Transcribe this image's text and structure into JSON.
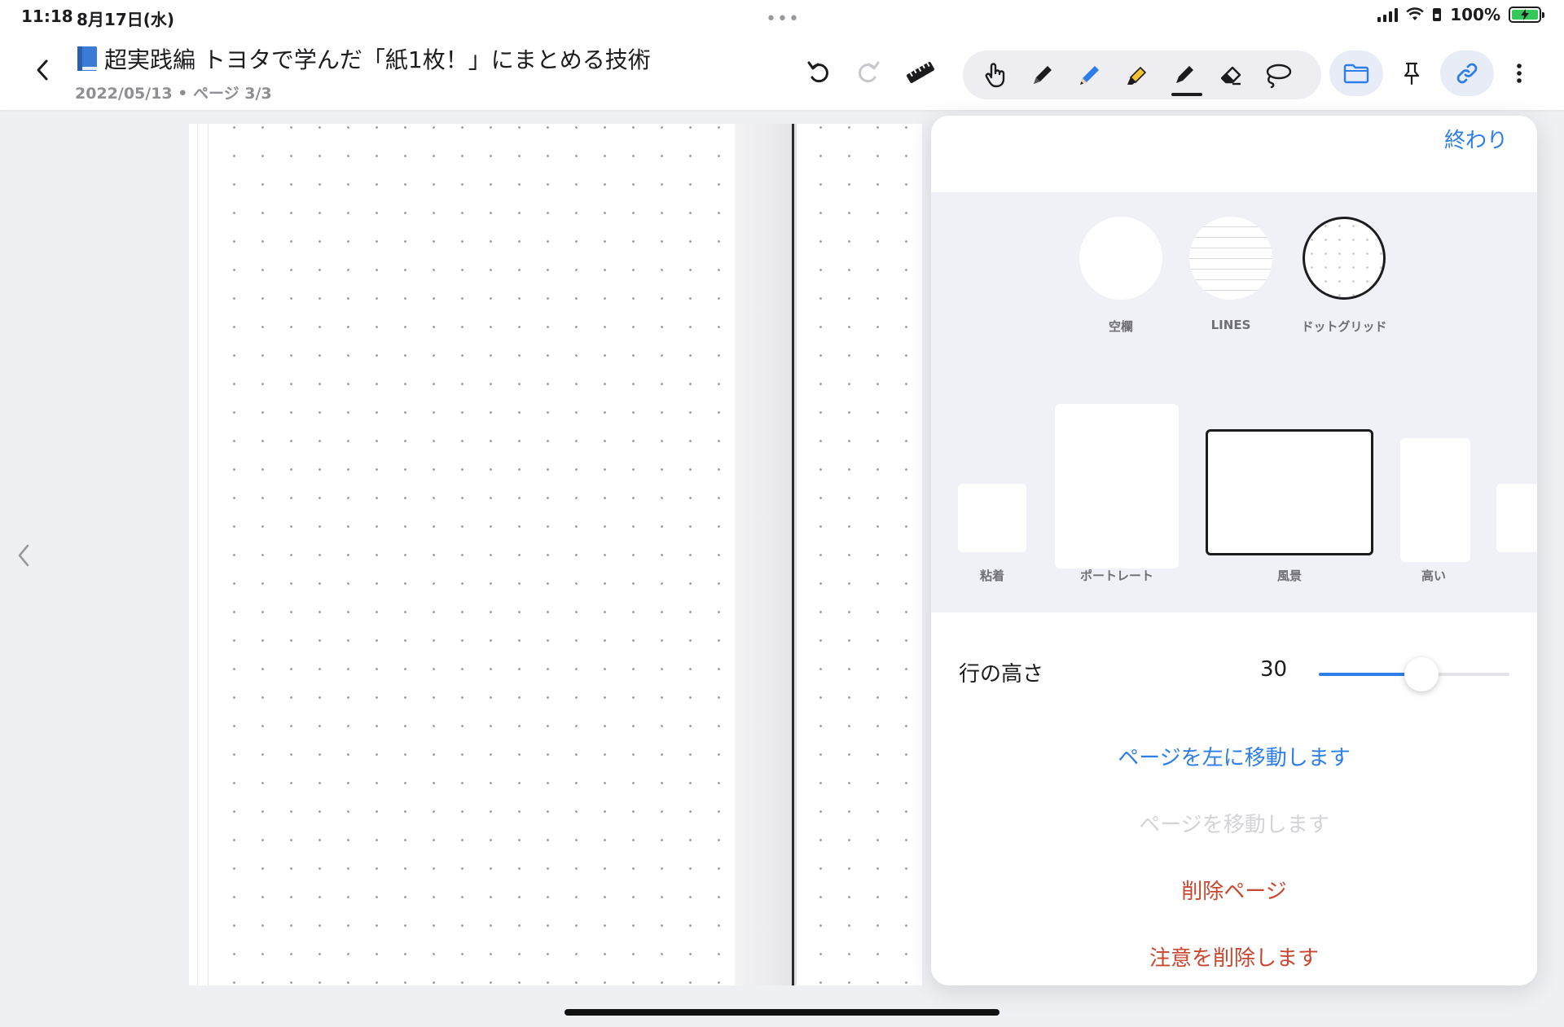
{
  "status_bar": {
    "time": "11:18",
    "date": "8月17日(水)",
    "multitask": "•••",
    "battery_percent": "100%"
  },
  "header": {
    "title": "超実践編 トヨタで学んだ「紙1枚！」にまとめる技術",
    "subtitle": "2022/05/13 • ページ 3/3",
    "icons": {
      "back": "chevron-left-icon",
      "book": "blue-book-icon",
      "undo": "undo-icon",
      "redo": "redo-icon",
      "ruler": "ruler-icon",
      "tools": [
        "hand-pointer-icon",
        "pen-icon",
        "pencil-icon",
        "highlighter-icon",
        "marker-icon",
        "eraser-icon",
        "lasso-icon"
      ],
      "active_tool": "marker-icon",
      "folder": "folder-icon",
      "pin": "pin-icon",
      "link": "link-icon",
      "more": "more-vertical-icon"
    }
  },
  "notebook": {
    "template": "dot-grid",
    "spread": "two-page"
  },
  "popover": {
    "done_label": "終わり",
    "templates": [
      {
        "label": "空欄",
        "selected": false
      },
      {
        "label": "LINES",
        "selected": false
      },
      {
        "label": "ドットグリッド",
        "selected": true
      }
    ],
    "sizes": [
      {
        "label": "粘着",
        "selected": false
      },
      {
        "label": "ポートレート",
        "selected": false
      },
      {
        "label": "風景",
        "selected": true
      },
      {
        "label": "高い",
        "selected": false
      }
    ],
    "row_height": {
      "label": "行の高さ",
      "value": "30",
      "level": 0.54
    },
    "actions": {
      "move_left": "ページを左に移動します",
      "move_page": "ページを移動します",
      "delete_page": "削除ページ",
      "delete_note": "注意を削除します"
    }
  },
  "colors": {
    "accent": "#2d7ee8",
    "danger": "#c9472f",
    "battery": "#34c759"
  }
}
